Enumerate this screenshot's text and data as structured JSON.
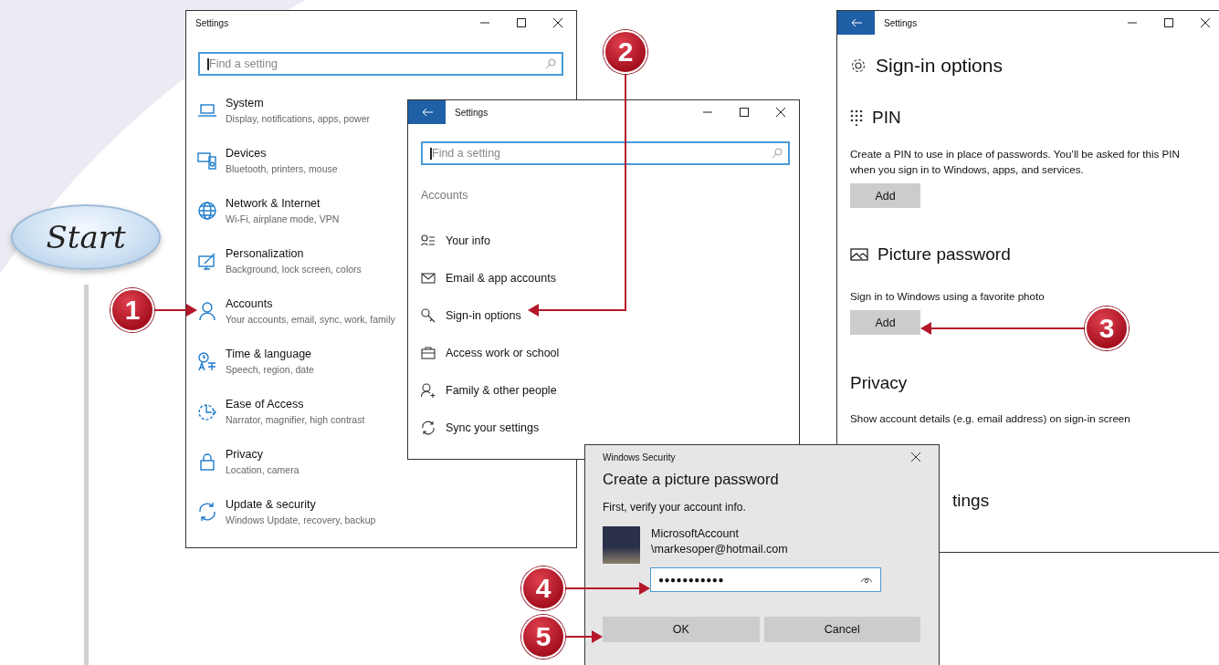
{
  "badge": {
    "label": "Start"
  },
  "steps": [
    {
      "number": "1"
    },
    {
      "number": "2"
    },
    {
      "number": "3"
    },
    {
      "number": "4"
    },
    {
      "number": "5"
    }
  ],
  "settings_window": {
    "title": "Settings",
    "search": {
      "placeholder": "Find a setting"
    },
    "items": [
      {
        "label": "System",
        "description": "Display, notifications, apps, power"
      },
      {
        "label": "Devices",
        "description": "Bluetooth, printers, mouse"
      },
      {
        "label": "Network & Internet",
        "description": "Wi-Fi, airplane mode, VPN"
      },
      {
        "label": "Personalization",
        "description": "Background, lock screen, colors"
      },
      {
        "label": "Accounts",
        "description": "Your accounts, email, sync, work, family"
      },
      {
        "label": "Time & language",
        "description": "Speech, region, date"
      },
      {
        "label": "Ease of Access",
        "description": "Narrator, magnifier, high contrast"
      },
      {
        "label": "Privacy",
        "description": "Location, camera"
      },
      {
        "label": "Update & security",
        "description": "Windows Update, recovery, backup"
      }
    ]
  },
  "accounts_window": {
    "title": "Settings",
    "search": {
      "placeholder": "Find a setting"
    },
    "section": "Accounts",
    "items": [
      {
        "label": "Your info"
      },
      {
        "label": "Email & app accounts"
      },
      {
        "label": "Sign-in options"
      },
      {
        "label": "Access work or school"
      },
      {
        "label": "Family & other people"
      },
      {
        "label": "Sync your settings"
      }
    ]
  },
  "signin_window": {
    "title": "Settings",
    "heading": "Sign-in options",
    "pin": {
      "heading": "PIN",
      "description": "Create a PIN to use in place of passwords. You’ll be asked for this PIN when you sign in to Windows, apps, and services.",
      "button": "Add"
    },
    "picture_password": {
      "heading": "Picture password",
      "description": "Sign in to Windows using a favorite photo",
      "button": "Add"
    },
    "privacy": {
      "heading": "Privacy",
      "description": "Show account details (e.g. email address) on sign-in screen"
    },
    "partial_heading": "tings"
  },
  "dialog": {
    "title": "Windows Security",
    "heading": "Create a picture password",
    "prompt": "First, verify your account info.",
    "account": [
      "MicrosoftAccount",
      "\\markesoper@hotmail.com"
    ],
    "password": "●●●●●●●●●●●",
    "buttons": [
      "OK",
      "Cancel"
    ]
  }
}
